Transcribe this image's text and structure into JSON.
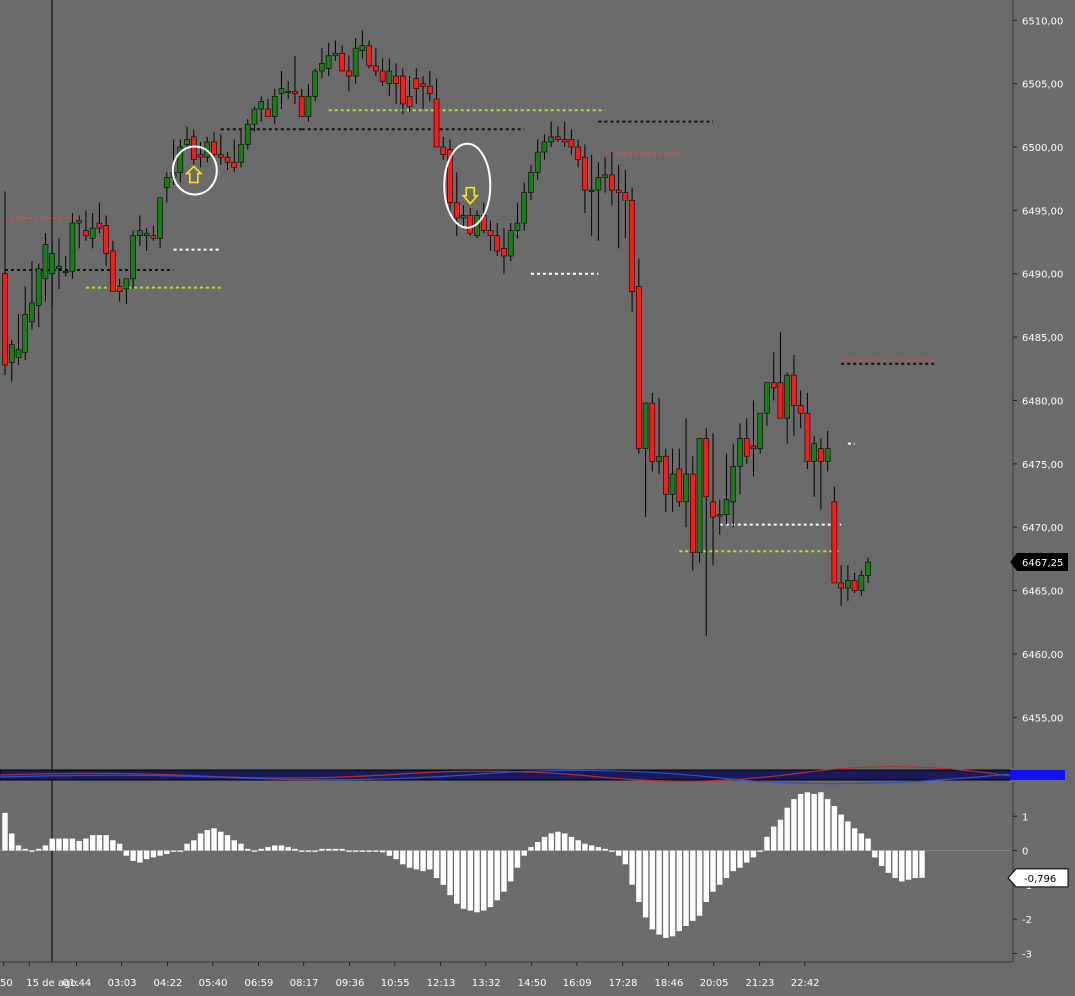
{
  "chart_data": [
    {
      "type": "candlestick",
      "y_axis": {
        "ylim": [
          6451.0,
          6511.6
        ],
        "ticks": [
          "6455,00",
          "6460,00",
          "6465,00",
          "6470,00",
          "6475,00",
          "6480,00",
          "6485,00",
          "6490,00",
          "6495,00",
          "6500,00",
          "6505,00",
          "6510,00"
        ],
        "tick_values": [
          6455,
          6460,
          6465,
          6470,
          6475,
          6480,
          6485,
          6490,
          6495,
          6500,
          6505,
          6510
        ]
      },
      "last_price_label": "6467,25",
      "last_price": 6467.25,
      "candles": [
        [
          6490.0,
          6496.5,
          6482.0,
          6482.8
        ],
        [
          6483.0,
          6484.8,
          6481.5,
          6484.4
        ],
        [
          6483.4,
          6486.8,
          6482.8,
          6484.0
        ],
        [
          6483.8,
          6489.0,
          6483.2,
          6486.8
        ],
        [
          6486.2,
          6491.0,
          6485.6,
          6487.7
        ],
        [
          6487.5,
          6490.8,
          6485.8,
          6490.4
        ],
        [
          6489.6,
          6493.2,
          6487.8,
          6492.3
        ],
        [
          6490.0,
          6492.6,
          6487.4,
          6491.6
        ],
        [
          6490.4,
          6492.8,
          6488.8,
          6490.6
        ],
        [
          6490.2,
          6491.4,
          6489.8,
          6490.2
        ],
        [
          6490.2,
          6494.8,
          6489.6,
          6494.0
        ],
        [
          6494.0,
          6494.6,
          6492.0,
          6494.2
        ],
        [
          6493.4,
          6495.0,
          6492.6,
          6493.0
        ],
        [
          6492.8,
          6494.8,
          6492.0,
          6493.6
        ],
        [
          6494.0,
          6495.6,
          6493.2,
          6493.6
        ],
        [
          6493.8,
          6494.6,
          6490.6,
          6491.6
        ],
        [
          6491.8,
          6492.6,
          6489.0,
          6488.6
        ],
        [
          6489.0,
          6489.6,
          6487.8,
          6488.6
        ],
        [
          6488.8,
          6489.4,
          6487.6,
          6489.6
        ],
        [
          6489.6,
          6493.4,
          6488.8,
          6493.0
        ],
        [
          6493.0,
          6494.6,
          6492.2,
          6493.4
        ],
        [
          6493.0,
          6493.6,
          6491.8,
          6493.2
        ],
        [
          6493.0,
          6493.8,
          6492.6,
          6492.8
        ],
        [
          6492.8,
          6496.0,
          6492.0,
          6496.0
        ],
        [
          6496.8,
          6498.0,
          6495.6,
          6497.6
        ],
        [
          6497.6,
          6500.6,
          6497.0,
          6498.0
        ],
        [
          6498.0,
          6500.6,
          6497.2,
          6500.0
        ],
        [
          6500.2,
          6501.6,
          6499.8,
          6500.6
        ],
        [
          6500.8,
          6501.4,
          6498.6,
          6499.0
        ],
        [
          6499.4,
          6500.4,
          6498.4,
          6499.2
        ],
        [
          6499.2,
          6500.8,
          6498.8,
          6500.4
        ],
        [
          6500.4,
          6501.2,
          6499.0,
          6499.4
        ],
        [
          6499.4,
          6501.0,
          6498.6,
          6499.2
        ],
        [
          6499.2,
          6499.6,
          6498.2,
          6498.8
        ],
        [
          6498.8,
          6500.6,
          6498.0,
          6498.4
        ],
        [
          6498.8,
          6501.4,
          6498.4,
          6500.2
        ],
        [
          6500.2,
          6502.2,
          6499.8,
          6501.8
        ],
        [
          6501.8,
          6503.2,
          6501.2,
          6503.0
        ],
        [
          6503.0,
          6504.0,
          6502.0,
          6503.6
        ],
        [
          6503.0,
          6503.8,
          6502.6,
          6502.4
        ],
        [
          6502.4,
          6504.6,
          6501.8,
          6504.0
        ],
        [
          6504.2,
          6506.0,
          6503.0,
          6504.6
        ],
        [
          6504.4,
          6505.2,
          6503.8,
          6504.4
        ],
        [
          6504.4,
          6507.2,
          6503.4,
          6504.2
        ],
        [
          6504.0,
          6504.6,
          6502.6,
          6502.4
        ],
        [
          6502.4,
          6505.0,
          6502.0,
          6504.0
        ],
        [
          6504.0,
          6506.2,
          6503.6,
          6506.0
        ],
        [
          6506.0,
          6507.8,
          6505.4,
          6506.6
        ],
        [
          6506.2,
          6508.2,
          6505.6,
          6507.2
        ],
        [
          6507.2,
          6508.4,
          6506.8,
          6507.4
        ],
        [
          6507.4,
          6508.0,
          6506.0,
          6506.0
        ],
        [
          6506.0,
          6507.2,
          6504.4,
          6505.6
        ],
        [
          6505.6,
          6508.6,
          6505.0,
          6507.8
        ],
        [
          6507.6,
          6509.2,
          6507.0,
          6508.0
        ],
        [
          6508.0,
          6508.4,
          6506.2,
          6506.4
        ],
        [
          6506.4,
          6507.8,
          6505.6,
          6506.0
        ],
        [
          6506.0,
          6507.0,
          6504.8,
          6505.2
        ],
        [
          6505.0,
          6507.0,
          6504.0,
          6506.0
        ],
        [
          6505.6,
          6506.6,
          6503.4,
          6505.0
        ],
        [
          6505.6,
          6506.2,
          6502.6,
          6503.4
        ],
        [
          6504.0,
          6505.6,
          6502.8,
          6503.2
        ],
        [
          6505.4,
          6506.2,
          6503.4,
          6504.6
        ],
        [
          6505.0,
          6505.6,
          6503.0,
          6504.8
        ],
        [
          6504.8,
          6506.0,
          6503.6,
          6504.2
        ],
        [
          6503.8,
          6505.4,
          6502.2,
          6500.0
        ],
        [
          6500.0,
          6500.8,
          6499.0,
          6499.4
        ],
        [
          6499.8,
          6500.6,
          6495.0,
          6495.6
        ],
        [
          6495.6,
          6498.0,
          6493.0,
          6494.4
        ],
        [
          6494.4,
          6495.4,
          6493.6,
          6494.6
        ],
        [
          6494.6,
          6495.2,
          6493.0,
          6493.2
        ],
        [
          6493.0,
          6495.0,
          6492.8,
          6494.6
        ],
        [
          6494.6,
          6495.6,
          6493.2,
          6493.4
        ],
        [
          6493.4,
          6494.2,
          6491.8,
          6493.0
        ],
        [
          6493.0,
          6494.0,
          6491.4,
          6491.8
        ],
        [
          6492.0,
          6493.6,
          6490.0,
          6491.4
        ],
        [
          6491.4,
          6494.0,
          6491.0,
          6493.4
        ],
        [
          6493.4,
          6495.6,
          6492.8,
          6494.0
        ],
        [
          6494.0,
          6497.2,
          6493.4,
          6496.4
        ],
        [
          6496.4,
          6498.6,
          6495.8,
          6498.0
        ],
        [
          6498.0,
          6500.6,
          6497.4,
          6499.6
        ],
        [
          6499.6,
          6501.0,
          6499.0,
          6500.4
        ],
        [
          6500.4,
          6502.0,
          6500.0,
          6500.8
        ],
        [
          6500.8,
          6501.6,
          6500.4,
          6500.6
        ],
        [
          6500.6,
          6502.0,
          6500.0,
          6500.4
        ],
        [
          6500.6,
          6501.4,
          6499.4,
          6500.0
        ],
        [
          6500.0,
          6500.6,
          6498.4,
          6499.0
        ],
        [
          6499.2,
          6500.2,
          6494.8,
          6496.6
        ],
        [
          6496.6,
          6499.4,
          6493.0,
          6496.6
        ],
        [
          6496.6,
          6498.8,
          6492.6,
          6497.6
        ],
        [
          6497.6,
          6499.2,
          6496.4,
          6497.8
        ],
        [
          6497.8,
          6499.6,
          6495.4,
          6496.6
        ],
        [
          6496.6,
          6498.6,
          6492.0,
          6496.4
        ],
        [
          6496.4,
          6498.2,
          6492.8,
          6495.8
        ],
        [
          6495.8,
          6496.8,
          6487.0,
          6488.6
        ],
        [
          6489.0,
          6491.2,
          6475.8,
          6476.2
        ],
        [
          6476.2,
          6479.8,
          6470.8,
          6479.8
        ],
        [
          6479.8,
          6480.6,
          6474.4,
          6475.2
        ],
        [
          6475.2,
          6480.2,
          6474.2,
          6475.6
        ],
        [
          6475.6,
          6476.2,
          6471.2,
          6472.6
        ],
        [
          6472.6,
          6476.2,
          6471.2,
          6474.2
        ],
        [
          6474.6,
          6476.2,
          6471.6,
          6472.0
        ],
        [
          6472.0,
          6478.6,
          6470.0,
          6474.2
        ],
        [
          6474.2,
          6475.6,
          6466.6,
          6468.0
        ],
        [
          6468.0,
          6476.6,
          6467.2,
          6477.0
        ],
        [
          6477.0,
          6477.8,
          6461.4,
          6472.4
        ],
        [
          6472.0,
          6477.4,
          6467.0,
          6470.8
        ],
        [
          6471.0,
          6472.2,
          6469.4,
          6471.0
        ],
        [
          6471.0,
          6475.8,
          6470.2,
          6472.2
        ],
        [
          6472.0,
          6476.6,
          6470.0,
          6474.8
        ],
        [
          6474.8,
          6478.2,
          6472.6,
          6477.0
        ],
        [
          6477.0,
          6478.6,
          6475.0,
          6475.6
        ],
        [
          6476.4,
          6480.0,
          6474.0,
          6476.2
        ],
        [
          6476.2,
          6478.6,
          6475.8,
          6479.0
        ],
        [
          6479.0,
          6481.4,
          6478.0,
          6481.4
        ],
        [
          6481.4,
          6483.8,
          6480.0,
          6481.0
        ],
        [
          6481.4,
          6485.4,
          6478.8,
          6478.6
        ],
        [
          6478.6,
          6482.2,
          6476.6,
          6482.0
        ],
        [
          6482.0,
          6483.6,
          6477.2,
          6479.6
        ],
        [
          6479.6,
          6480.8,
          6477.8,
          6479.0
        ],
        [
          6479.0,
          6480.6,
          6474.6,
          6475.2
        ],
        [
          6475.2,
          6477.2,
          6472.4,
          6476.6
        ],
        [
          6476.2,
          6477.0,
          6471.4,
          6475.2
        ],
        [
          6475.2,
          6477.6,
          6474.4,
          6476.2
        ],
        [
          6472.0,
          6473.2,
          6465.6,
          6465.6
        ],
        [
          6465.6,
          6467.0,
          6463.8,
          6465.2
        ],
        [
          6465.2,
          6467.0,
          6464.2,
          6465.8
        ],
        [
          6465.8,
          6466.4,
          6464.8,
          6465.0
        ],
        [
          6465.0,
          6466.6,
          6464.6,
          6466.2
        ],
        [
          6466.2,
          6467.6,
          6465.6,
          6467.25
        ]
      ],
      "levels": [
        {
          "price": 6494.4,
          "i0": 0,
          "i1": 11,
          "color": "#ff3b30"
        },
        {
          "price": 6490.3,
          "i0": 0,
          "i1": 25,
          "color": "#111111"
        },
        {
          "price": 6488.9,
          "i0": 12,
          "i1": 32,
          "color": "#a8e63a"
        },
        {
          "price": 6491.9,
          "i0": 25,
          "i1": 32,
          "color": "#ffffff"
        },
        {
          "price": 6501.4,
          "i0": 32,
          "i1": 44,
          "color": "#111111"
        },
        {
          "price": 6501.4,
          "i0": 44,
          "i1": 77,
          "color": "#111111"
        },
        {
          "price": 6502.9,
          "i0": 48,
          "i1": 89,
          "color": "#a8e63a"
        },
        {
          "price": 6490.0,
          "i0": 78,
          "i1": 88,
          "color": "#ffffff"
        },
        {
          "price": 6502.0,
          "i0": 88,
          "i1": 105,
          "color": "#111111"
        },
        {
          "price": 6499.5,
          "i0": 89,
          "i1": 100,
          "color": "#ff3b30"
        },
        {
          "price": 6468.1,
          "i0": 100,
          "i1": 124,
          "color": "#a8e63a"
        },
        {
          "price": 6470.2,
          "i0": 106,
          "i1": 124,
          "color": "#ffffff"
        },
        {
          "price": 6476.6,
          "i0": 125,
          "i1": 126,
          "color": "#ffffff"
        },
        {
          "price": 6482.9,
          "i0": 124,
          "i1": 138,
          "color": "#111111"
        },
        {
          "price": 6483.2,
          "i0": 124,
          "i1": 138,
          "color": "#ff3b30"
        }
      ],
      "signals": [
        {
          "index": 28,
          "direction": "up",
          "price": 6497.2
        },
        {
          "index": 69,
          "direction": "down",
          "price": 6496.0
        }
      ]
    },
    {
      "type": "bar",
      "ylim": [
        -3.25,
        2.0
      ],
      "ticks": [
        "1",
        "0",
        "-1",
        "-2",
        "-3"
      ],
      "tick_values": [
        1,
        0,
        -1,
        -2,
        -3
      ],
      "current_value_label": "-0,796",
      "values": [
        1.1,
        0.5,
        0.15,
        0.05,
        0.0,
        0.05,
        0.15,
        0.35,
        0.35,
        0.35,
        0.35,
        0.28,
        0.35,
        0.45,
        0.45,
        0.45,
        0.3,
        0.2,
        -0.15,
        -0.3,
        -0.35,
        -0.25,
        -0.2,
        -0.15,
        -0.1,
        0.0,
        0.0,
        0.2,
        0.3,
        0.5,
        0.6,
        0.65,
        0.55,
        0.45,
        0.3,
        0.2,
        0.05,
        0.0,
        0.05,
        0.1,
        0.15,
        0.15,
        0.1,
        0.05,
        0.0,
        0.0,
        0.0,
        0.05,
        0.05,
        0.05,
        0.05,
        0.0,
        0.0,
        0.0,
        0.0,
        0.0,
        -0.05,
        -0.15,
        -0.25,
        -0.4,
        -0.5,
        -0.55,
        -0.6,
        -0.55,
        -0.8,
        -1.0,
        -1.3,
        -1.55,
        -1.7,
        -1.75,
        -1.8,
        -1.75,
        -1.65,
        -1.45,
        -1.2,
        -0.9,
        -0.5,
        -0.15,
        0.1,
        0.25,
        0.4,
        0.5,
        0.55,
        0.5,
        0.4,
        0.3,
        0.2,
        0.15,
        0.1,
        0.05,
        0.0,
        -0.15,
        -0.4,
        -1.0,
        -1.5,
        -1.95,
        -2.3,
        -2.45,
        -2.55,
        -2.5,
        -2.35,
        -2.2,
        -2.05,
        -1.9,
        -1.5,
        -1.2,
        -1.0,
        -0.8,
        -0.6,
        -0.5,
        -0.35,
        -0.2,
        0.0,
        0.4,
        0.7,
        0.9,
        1.25,
        1.5,
        1.65,
        1.7,
        1.65,
        1.7,
        1.5,
        1.3,
        1.05,
        0.85,
        0.65,
        0.5,
        0.35,
        -0.2,
        -0.45,
        -0.65,
        -0.8,
        -0.9,
        -0.85,
        -0.8,
        -0.796
      ]
    }
  ],
  "x_axis": {
    "labels": [
      {
        "text": "50",
        "index": -0.2
      },
      {
        "text": "15 de ago.",
        "index": 3.6
      },
      {
        "text": "01:44",
        "index": 10.6
      },
      {
        "text": "03:03",
        "index": 17.3
      },
      {
        "text": "04:22",
        "index": 24.1
      },
      {
        "text": "05:40",
        "index": 30.8
      },
      {
        "text": "06:59",
        "index": 37.6
      },
      {
        "text": "08:17",
        "index": 44.3
      },
      {
        "text": "09:36",
        "index": 51.1
      },
      {
        "text": "10:55",
        "index": 57.8
      },
      {
        "text": "12:13",
        "index": 64.6
      },
      {
        "text": "13:32",
        "index": 71.3
      },
      {
        "text": "14:50",
        "index": 78.1
      },
      {
        "text": "16:09",
        "index": 84.8
      },
      {
        "text": "17:28",
        "index": 91.6
      },
      {
        "text": "18:46",
        "index": 98.4
      },
      {
        "text": "20:05",
        "index": 105.1
      },
      {
        "text": "21:23",
        "index": 111.9
      },
      {
        "text": "22:42",
        "index": 118.6
      }
    ]
  },
  "colors": {
    "background": "#6b6b6b",
    "up_candle": "#1a7d1a",
    "down_candle": "#ff1a1a",
    "wick": "#000000",
    "signal_arrow": "#ffea00",
    "histogram": "#ffffff",
    "strip_blue": "#1010ff"
  }
}
